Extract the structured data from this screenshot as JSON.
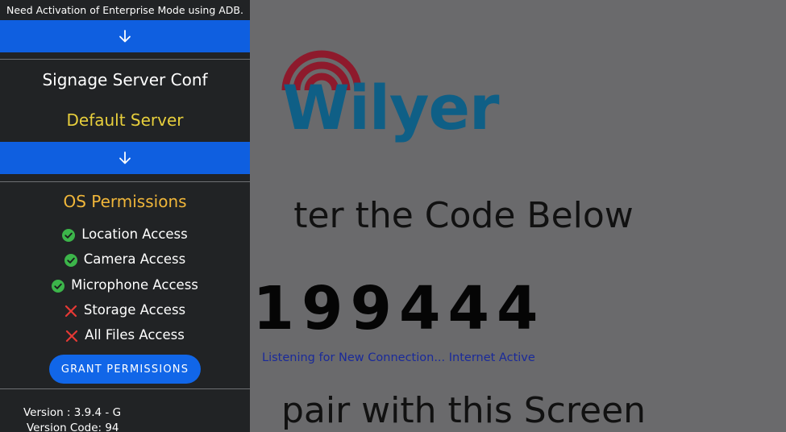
{
  "drawer": {
    "adb_note": "Need Activation of Enterprise Mode using ADB.",
    "server_section_title": "Signage Server Conf",
    "server_value": "Default Server",
    "permissions_title": "OS Permissions",
    "permissions": [
      {
        "label": "Location Access",
        "granted": true
      },
      {
        "label": "Camera Access",
        "granted": true
      },
      {
        "label": "Microphone Access",
        "granted": true
      },
      {
        "label": "Storage Access",
        "granted": false
      },
      {
        "label": "All Files Access",
        "granted": false
      }
    ],
    "grant_button_label": "GRANT PERMISSIONS",
    "version": "Version : 3.9.4 - G",
    "version_code": "Version Code: 94"
  },
  "main": {
    "logo_text": "Wilyer",
    "enter_code_heading": "ter the Code Below",
    "pairing_code": "199444",
    "status": "Listening for New Connection... Internet Active",
    "pair_heading": "pair with this Screen"
  },
  "colors": {
    "background": "#6a6a6c",
    "drawer": "#212325",
    "accent_blue": "#0f5fe0",
    "logo_blue": "#0f5f86",
    "logo_red": "#8e1a2c",
    "granted_green": "#3cb54a",
    "denied_red": "#e53935",
    "server_yellow": "#e8cf3c",
    "permissions_orange": "#f0b63a",
    "status_text": "#1a2a9a"
  },
  "icons": {
    "expand": "arrow-down-icon",
    "granted": "check-circle-icon",
    "denied": "close-x-icon"
  }
}
